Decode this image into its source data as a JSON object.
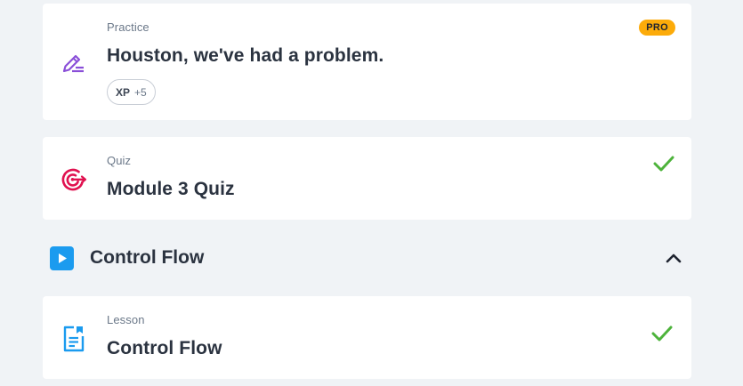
{
  "practice": {
    "type_label": "Practice",
    "title": "Houston, we've had a problem.",
    "badge": "PRO",
    "xp_label": "XP",
    "xp_value": "+5",
    "icon": "pencil-icon",
    "icon_color": "#8a4fd8",
    "badge_color": "#fcab0a"
  },
  "quiz": {
    "type_label": "Quiz",
    "title": "Module 3 Quiz",
    "icon": "target-icon",
    "icon_color": "#e0114f",
    "status_icon": "checkmark-icon",
    "status_color": "#4db33b"
  },
  "section": {
    "title": "Control Flow",
    "icon": "play-icon",
    "icon_color": "#1b9bef",
    "toggle_icon": "chevron-up-icon"
  },
  "lesson": {
    "type_label": "Lesson",
    "title": "Control Flow",
    "icon": "document-icon",
    "icon_color": "#1b9bef",
    "status_icon": "checkmark-icon",
    "status_color": "#4db33b"
  }
}
